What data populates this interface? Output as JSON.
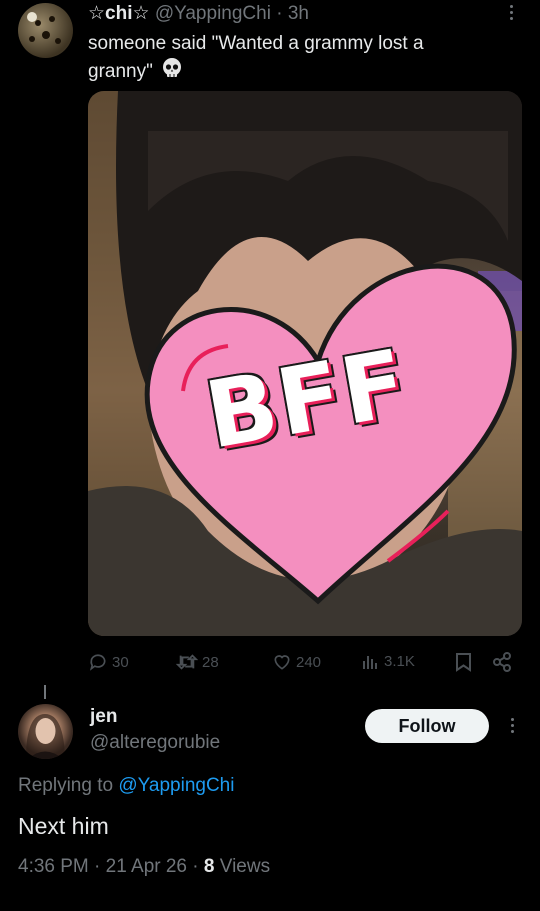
{
  "tweet": {
    "display_name": "☆chi☆",
    "handle": "@YappingChi",
    "separator": "·",
    "time": "3h",
    "text_line1": "someone said \"Wanted a grammy lost a",
    "text_line2": "granny\"",
    "emoji": "skull-emoji",
    "media_sticker_text": "BFF",
    "stats": {
      "replies": "30",
      "retweets": "28",
      "likes": "240",
      "views": "3.1K"
    }
  },
  "reply": {
    "display_name": "jen",
    "handle": "@alteregorubie",
    "follow_label": "Follow",
    "replying_prefix": "Replying to ",
    "replying_handle": "@YappingChi",
    "text": "Next him",
    "time": "4:36 PM",
    "date": "21 Apr 26",
    "views_count": "8",
    "views_label": "Views",
    "sep": "·"
  },
  "colors": {
    "background": "#000000",
    "text": "#e7e9ea",
    "muted": "#71767b",
    "link": "#1d9bf0",
    "sticker_pink": "#f48fbf",
    "sticker_red": "#e8205a"
  }
}
